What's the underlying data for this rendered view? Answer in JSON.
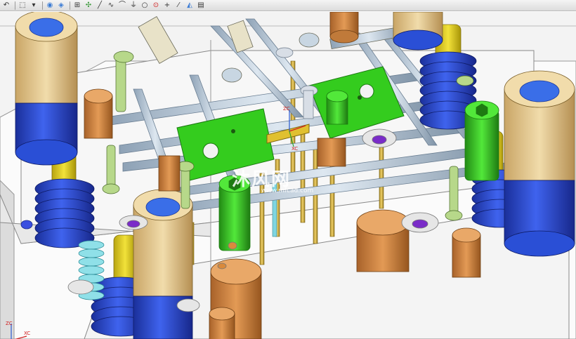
{
  "toolbar": {
    "icons": [
      "undo-icon",
      "select-box-icon",
      "dropdown-icon",
      "shaded-view-icon",
      "wireframe-view-icon",
      "snap-grid-icon",
      "snap-point-icon",
      "line-tool-icon",
      "curve-tool-icon",
      "arc-tool-icon",
      "tangent-tool-icon",
      "circle-tool-icon",
      "point-tool-icon",
      "plus-tool-icon",
      "slash-tool-icon",
      "measure-icon",
      "layer-icon"
    ]
  },
  "watermark": {
    "text": "沐风网",
    "url": "www.mfcad.com"
  },
  "csys": {
    "z_label": "ZC",
    "x_label": "XC",
    "y_label": "YC"
  },
  "colors": {
    "plate": "#f7f7f7",
    "green_plate": "#32c81e",
    "blue_spring": "#2a4fd6",
    "tan_bushing": "#e8c98c",
    "orange_post": "#d98a3c",
    "yellow_pin": "#e6d21e",
    "steel_bar": "#b8c8d8",
    "cyan_spring": "#8fe0e8"
  }
}
